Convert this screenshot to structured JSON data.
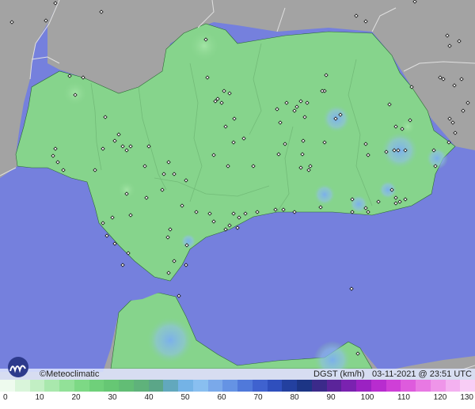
{
  "map": {
    "credit": "©Meteoclimatic",
    "product": "DGST (km/h)",
    "timestamp": "03-11-2021 @ 23:51 UTC",
    "colors": {
      "sea": "#7580dd",
      "land_outside": "#a3a3a3",
      "region_land": "#86d48c",
      "borders": "#dddddd",
      "station_marker": "#111111"
    }
  },
  "legend": {
    "ticks": [
      "0",
      "10",
      "20",
      "30",
      "40",
      "50",
      "60",
      "70",
      "80",
      "90",
      "100",
      "110",
      "120",
      "130"
    ],
    "colors": [
      "#eefbee",
      "#d9f5da",
      "#c2efc4",
      "#a9e8ad",
      "#92e198",
      "#7dd985",
      "#6fd07a",
      "#66c774",
      "#62bd75",
      "#5fb27b",
      "#5ba688",
      "#62a8bd",
      "#74b3e6",
      "#89bff0",
      "#7aa9ea",
      "#6593e4",
      "#5079da",
      "#3f62cf",
      "#2f4fbd",
      "#23409f",
      "#1c3585",
      "#3b2a8a",
      "#5b249a",
      "#7a22b0",
      "#9b22c2",
      "#b82ccf",
      "#cf3fd7",
      "#de5bdd",
      "#e879e3",
      "#ef95e9",
      "#f4b1f0",
      "#f8cdf5"
    ]
  }
}
